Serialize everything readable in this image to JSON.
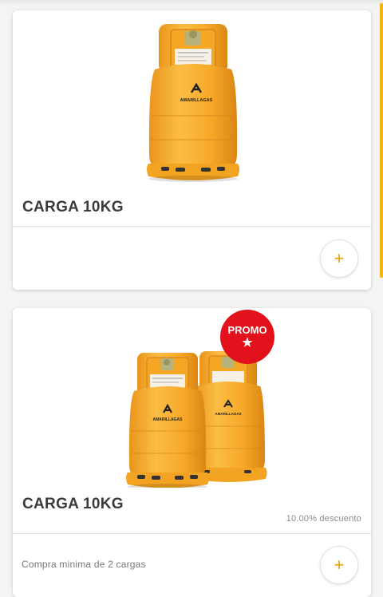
{
  "colors": {
    "accent": "#f5b416",
    "cylinder": "#f9b233",
    "promo": "#e3111b",
    "plus": "#e8a400"
  },
  "products": [
    {
      "title": "CARGA 10KG",
      "image_icon": "gas-cylinder-icon",
      "cylinder_brand": "AMARILLAGAS",
      "add_symbol": "+"
    },
    {
      "title": "CARGA 10KG",
      "image_icon": "two-gas-cylinders-icon",
      "cylinder_brand": "AMARILLAGAS",
      "promo_label": "PROMO",
      "promo_star": "★",
      "discount": "10.00% descuento",
      "min_note": "Compra minima de 2 cargas",
      "add_symbol": "+"
    }
  ]
}
